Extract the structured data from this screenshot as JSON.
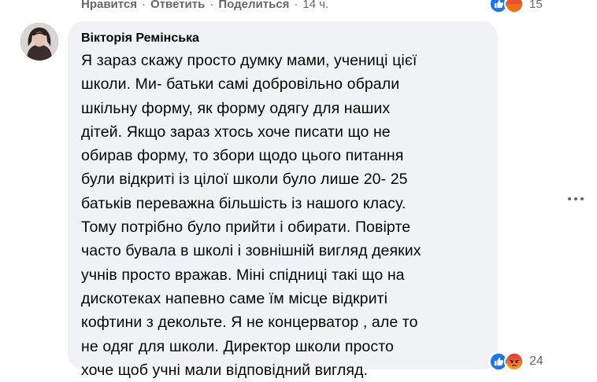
{
  "top_actions": {
    "like": "Нравится",
    "reply": "Ответить",
    "share": "Поделиться",
    "time": "14 ч.",
    "separator": "·",
    "reaction_count": "15"
  },
  "comment": {
    "author": "Вікторія Ремінська",
    "lines": [
      "Я зараз скажу просто думку мами, учениці цієї",
      "школи. Ми- батьки самі добровільно обрали",
      "шкільну форму, як форму одягу для наших",
      "дітей. Якщо зараз хтось хоче писати що не",
      "обирав форму, то збори щодо цього питання",
      "були відкриті із цілої школи було лише 20- 25",
      "батьків переважна більшість із нашого класу.",
      "Тому потрібно було прийти і обирати. Повірте",
      "часто бувала в школі і зовнішній вигляд деяких",
      "учнів просто вражав. Міні спідниці такі що на",
      "дискотеках напевно саме їм місце відкриті",
      "кофтини з декольте. Я не концерватор , але то",
      "не одяг для школи. Директор школи просто",
      "хоче щоб учні мали відповідний вигляд."
    ],
    "reactions": {
      "icons": [
        "like-icon",
        "angry-icon"
      ],
      "count": "24"
    }
  },
  "colors": {
    "bubble": "#f0f2f5",
    "meta_text": "#65676b",
    "like_blue": "#1877f2",
    "angry_orange": "#e9710f"
  }
}
